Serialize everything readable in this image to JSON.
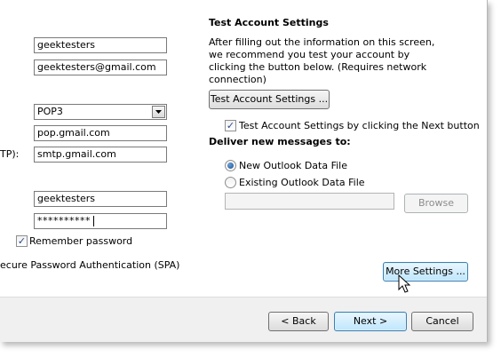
{
  "left": {
    "your_name": "geektesters",
    "email": "geektesters@gmail.com",
    "account_type": "POP3",
    "incoming_server": "pop.gmail.com",
    "outgoing_label_fragment": "TP):",
    "outgoing_server": "smtp.gmail.com",
    "user_name": "geektesters",
    "password": "**********",
    "remember_password_label": "Remember password",
    "spa_label_fragment": "ecure Password Authentication (SPA)"
  },
  "right": {
    "title": "Test Account Settings",
    "description": "After filling out the information on this screen, we recommend you test your account by clicking the button below. (Requires network connection)",
    "test_button": "Test Account Settings ...",
    "test_next_checkbox_label": "Test Account Settings by clicking the Next button",
    "deliver_heading": "Deliver new messages to:",
    "radio_new": "New Outlook Data File",
    "radio_existing": "Existing Outlook Data File",
    "existing_file_path": "",
    "browse_button": "Browse",
    "more_settings_button": "More Settings ..."
  },
  "footer": {
    "back": "< Back",
    "next": "Next >",
    "cancel": "Cancel"
  },
  "state": {
    "remember_password": true,
    "test_by_next": true,
    "deliver_to": "new"
  },
  "icons": {
    "dropdown_arrow": "triangle-down",
    "cursor": "mouse-pointer-arrow"
  }
}
